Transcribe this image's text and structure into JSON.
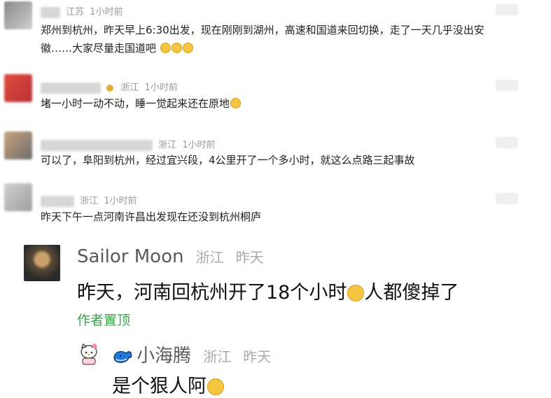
{
  "comments": [
    {
      "location": "江苏",
      "time": "1小时前",
      "text_line1": "郑州到杭州，昨天早上6:30出发，现在刚刚到湖州，高速和国道来回切换，走了一天几乎没出安",
      "text_line2": "徽……大家尽量走国道吧",
      "emoji": "😳😳😳"
    },
    {
      "location": "浙江",
      "time": "1小时前",
      "text": "堵一小时一动不动，睡一觉起来还在原地",
      "emoji": "😳"
    },
    {
      "location": "浙江",
      "time": "1小时前",
      "text": "可以了，阜阳到杭州，经过宜兴段，4公里开了一个多小时，就这么点路三起事故"
    },
    {
      "location": "浙江",
      "time": "1小时前",
      "text": "昨天下午一点河南许昌出发现在还没到杭州桐庐"
    }
  ],
  "featured": {
    "name": "Sailor Moon",
    "location": "浙江",
    "time": "昨天",
    "text_before": "昨天，河南回杭州开了18个小时",
    "emoji": "😭",
    "text_after": "人都傻掉了",
    "pinned_label": "作者置顶"
  },
  "reply": {
    "name": "小海腾",
    "location": "浙江",
    "time": "昨天",
    "text": "是个狠人阿",
    "emoji": "😂"
  }
}
